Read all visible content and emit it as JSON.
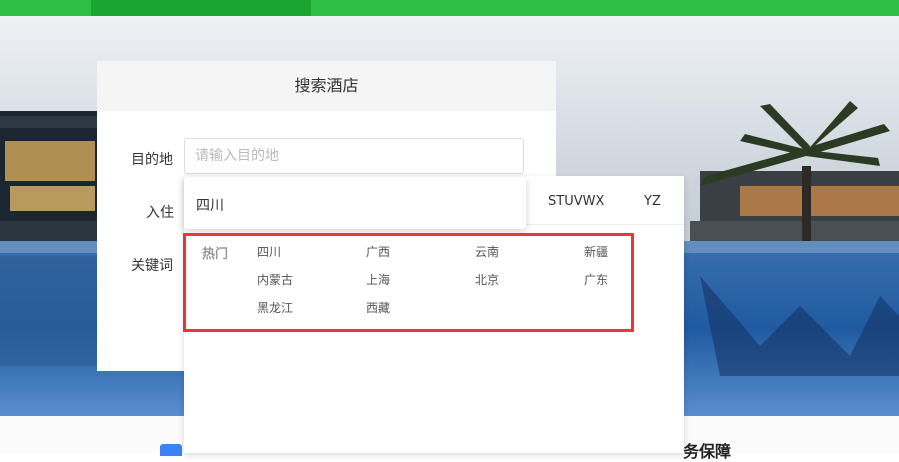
{
  "nav": {
    "items": [
      "",
      "",
      "",
      "",
      "",
      "",
      "",
      "",
      ""
    ]
  },
  "search_card": {
    "title": "搜索酒店",
    "destination_label": "目的地",
    "destination_placeholder": "请输入目的地",
    "checkin_label": "入住",
    "keyword_label": "关键词"
  },
  "suggestion": {
    "item": "四川"
  },
  "letter_tabs": [
    "STUVWX",
    "YZ"
  ],
  "hot": {
    "label": "热门",
    "cities": [
      "四川",
      "广西",
      "云南",
      "新疆",
      "内蒙古",
      "上海",
      "北京",
      "广东",
      "黑龙江",
      "西藏"
    ]
  },
  "section_heading": "务保障",
  "colors": {
    "nav_green": "#2fbf46",
    "nav_active": "#1aa533",
    "highlight_border": "#e5383b"
  }
}
